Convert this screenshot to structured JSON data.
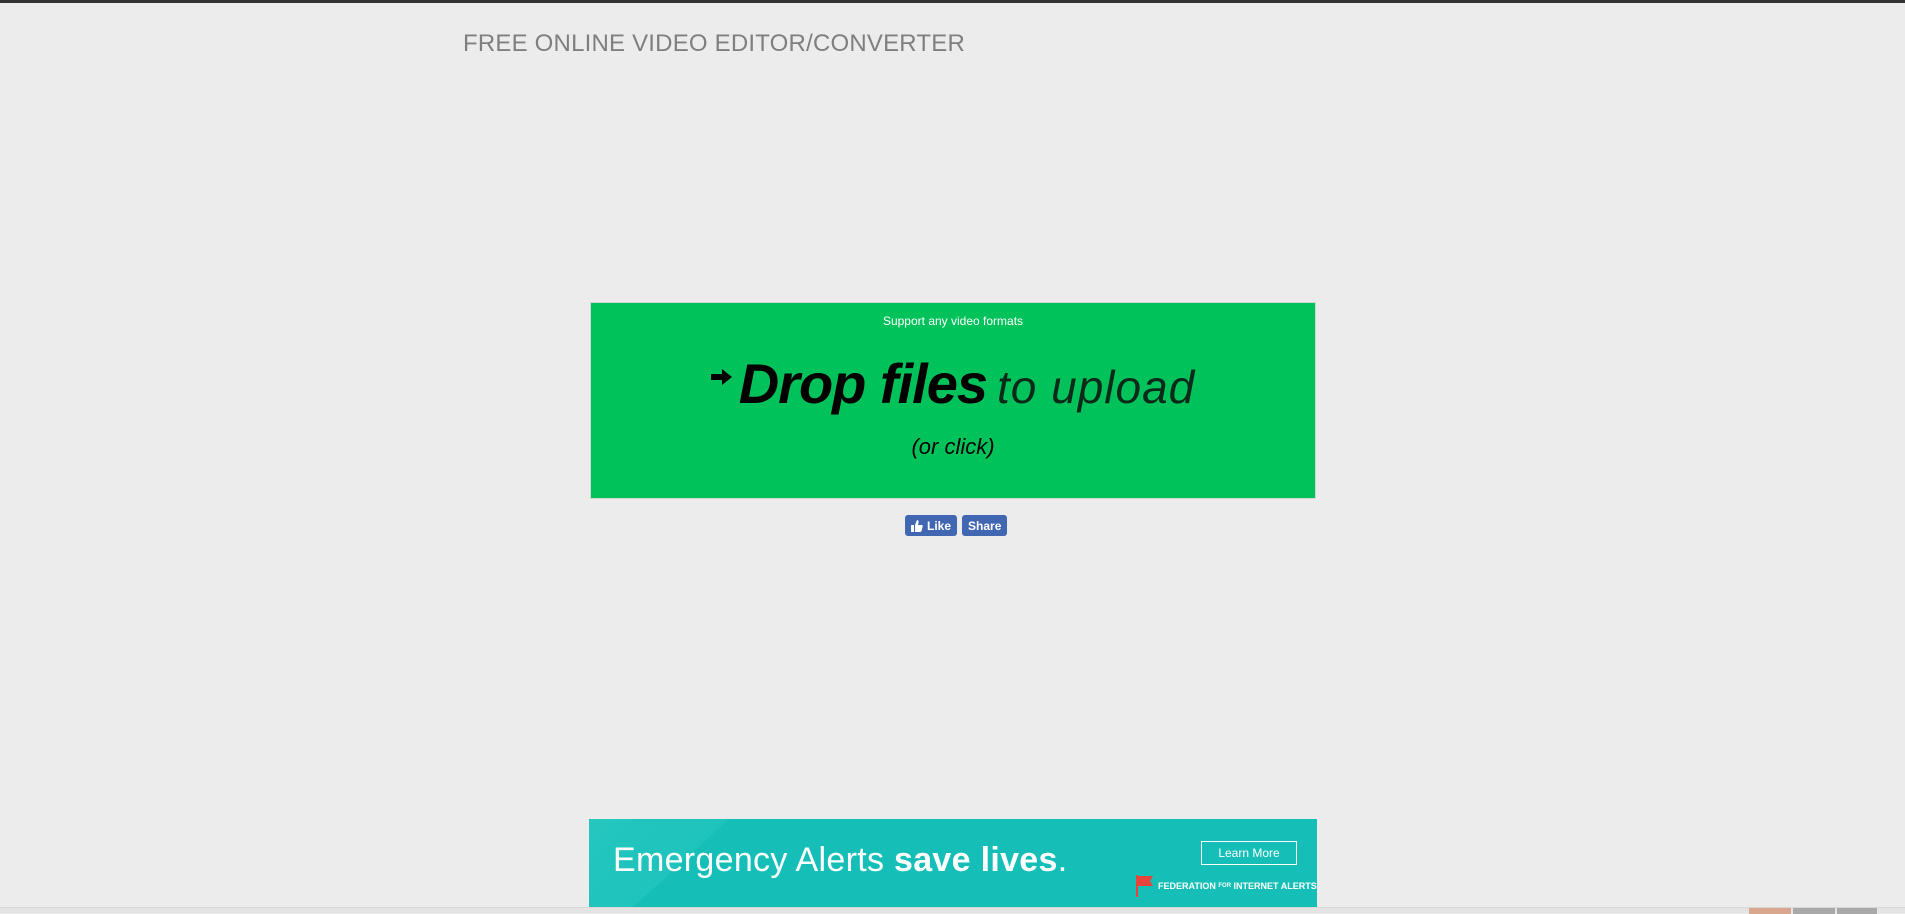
{
  "site": {
    "title": "FREE ONLINE VIDEO EDITOR/CONVERTER"
  },
  "dropzone": {
    "formats_text": "Support any video formats",
    "arrow_icon": "arrow-right-icon",
    "drop_strong": "Drop files",
    "drop_light": "to upload",
    "or_click": "(or click)",
    "background_color": "#00c25a"
  },
  "social": {
    "like_label": "Like",
    "share_label": "Share",
    "like_icon": "thumbs-up-icon",
    "color": "#4267b2"
  },
  "ad": {
    "headline_light": "Emergency Alerts ",
    "headline_bold": "save lives",
    "headline_end": ".",
    "button_label": "Learn More",
    "org_small_a": "FEDERATION",
    "org_small_b": "FOR",
    "org_small_c": "INTERNET ALERTS",
    "flag_icon": "red-flag-icon",
    "background_color": "#15bfb7"
  }
}
